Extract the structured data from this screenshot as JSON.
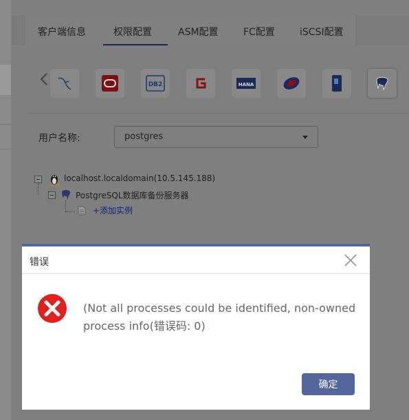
{
  "tabs": [
    {
      "label": "客户端信息"
    },
    {
      "label": "权限配置"
    },
    {
      "label": "ASM配置"
    },
    {
      "label": "FC配置"
    },
    {
      "label": "iSCSI配置"
    }
  ],
  "db_icons": [
    {
      "name": "mysql-icon"
    },
    {
      "name": "oracle-icon",
      "text": ""
    },
    {
      "name": "db2-icon",
      "text": "DB2"
    },
    {
      "name": "gbase-icon",
      "text": ""
    },
    {
      "name": "hana-icon",
      "text": "HANA"
    },
    {
      "name": "sybase-icon"
    },
    {
      "name": "informix-icon"
    },
    {
      "name": "postgresql-icon"
    }
  ],
  "user": {
    "label": "用户名称:",
    "value": "postgres"
  },
  "tree": {
    "host": "localhost.localdomain(10.5.145.188)",
    "server": "PostgreSQL数据库备份服务器",
    "add_instance": "+添加实例"
  },
  "dialog": {
    "title": "错误",
    "message": "(Not all processes could be identified, non-owned process info(错误码: 0)",
    "ok_label": "确定",
    "accent": "#53659a",
    "error_color": "#e02020"
  }
}
